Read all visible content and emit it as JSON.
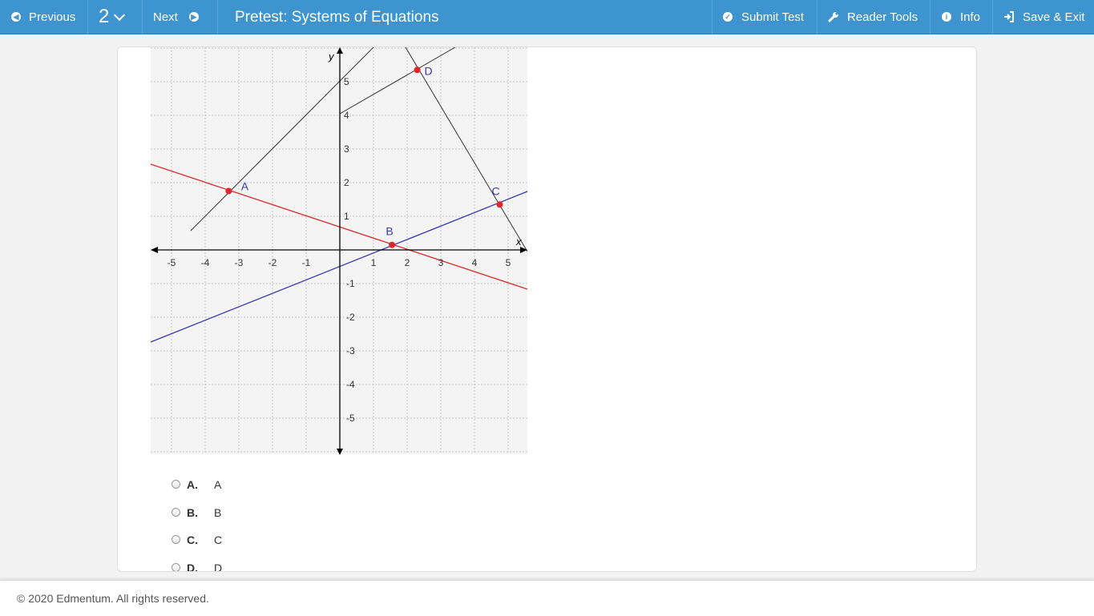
{
  "nav": {
    "previous_label": "Previous",
    "question_number": "2",
    "next_label": "Next",
    "title": "Pretest: Systems of Equations",
    "submit_label": "Submit Test",
    "reader_label": "Reader Tools",
    "info_label": "Info",
    "save_label": "Save & Exit"
  },
  "graph": {
    "x_axis_label": "x",
    "y_axis_label": "y",
    "x_ticks": [
      "-5",
      "-4",
      "-3",
      "-2",
      "-1",
      "1",
      "2",
      "3",
      "4",
      "5"
    ],
    "y_ticks_pos": [
      "1",
      "2",
      "3",
      "4",
      "5"
    ],
    "y_ticks_neg": [
      "-1",
      "-2",
      "-3",
      "-4",
      "-5"
    ],
    "points": [
      {
        "label": "A",
        "x": -3.3,
        "y": 1.75
      },
      {
        "label": "B",
        "x": 1.55,
        "y": 0.15
      },
      {
        "label": "C",
        "x": 4.75,
        "y": 1.35
      },
      {
        "label": "D",
        "x": 2.3,
        "y": 5.35
      }
    ],
    "colors": {
      "red": "#e0262b",
      "blue": "#3a3ab0",
      "black": "#333333",
      "label": "#3a3ab0"
    }
  },
  "choices": [
    {
      "letter": "A.",
      "text": "A"
    },
    {
      "letter": "B.",
      "text": "B"
    },
    {
      "letter": "C.",
      "text": "C"
    },
    {
      "letter": "D.",
      "text": "D"
    }
  ],
  "footer": {
    "copyright": "© 2020 Edmentum. All rights reserved."
  }
}
